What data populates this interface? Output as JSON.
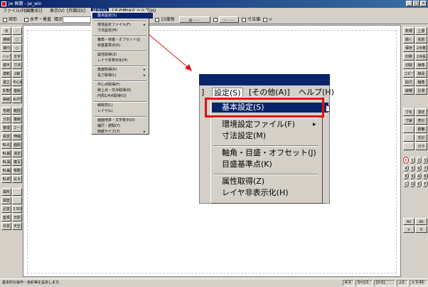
{
  "window": {
    "title": "jw 無題 - jw_win",
    "minimize": "_",
    "maximize": "□",
    "close": "×"
  },
  "menubar": {
    "items": [
      "ファイル(F)",
      "[編集(E)]",
      "表示(V)",
      "[作図(D)]",
      "設定(S)",
      "[その他(A)]",
      "ヘルプ(H)"
    ]
  },
  "toolbar": {
    "rect_label": "矩形",
    "hv_label": "水平・垂直",
    "tilt_label": "傾き",
    "dim_value_label": "寸法値",
    "ratio_label": "15度毎",
    "dot_arrow": "●――",
    "angle_arrow": "<――",
    "lt_label": "<"
  },
  "left_tools": [
    [
      "点",
      "／"
    ],
    [
      "接線",
      "□"
    ],
    [
      "接円",
      "○"
    ],
    [
      "ハッチ",
      "文字"
    ],
    [
      "建平",
      "寸法"
    ],
    [
      "建断",
      "2線"
    ],
    [
      "建立",
      "中心線"
    ],
    [
      "多角形",
      "連線"
    ],
    [
      "曲線",
      "AUTO"
    ],
    [
      "包絡",
      "範囲"
    ],
    [
      "分割",
      "複線"
    ],
    [
      "整理",
      "コーナー"
    ],
    [
      "属変",
      "伸縮"
    ],
    [
      "BL化",
      "面取"
    ],
    [
      "BL解",
      "消去"
    ],
    [
      "BL属",
      "複写"
    ],
    [
      "BL編",
      "移動"
    ],
    [
      "BL終",
      "戻る"
    ],
    [
      "図形",
      ""
    ],
    [
      "図登",
      ""
    ],
    [
      "記変",
      "2.5D"
    ],
    [
      "座標",
      "日影"
    ],
    [
      "外変",
      "天空"
    ]
  ],
  "right_tools": [
    [
      "新規",
      "上書"
    ],
    [
      "開く",
      "名前"
    ],
    [
      "保存",
      "2点角"
    ],
    [
      "印刷",
      "2点長"
    ],
    [
      "切取",
      "線角"
    ],
    [
      "コピー",
      "線長"
    ],
    [
      "貼付",
      "軸角"
    ],
    [
      "線種",
      "計測"
    ],
    [
      "寸化",
      "測定"
    ],
    [
      "寸解",
      "表計"
    ],
    [
      "",
      "距離"
    ],
    [
      "",
      "式計"
    ],
    [
      "",
      "ガラ"
    ]
  ],
  "layer_buttons": [
    "0",
    "1",
    "2",
    "3",
    "4",
    "5",
    "6",
    "7",
    "8",
    "9",
    "A",
    "B",
    "C",
    "D",
    "E",
    "F"
  ],
  "layer_extra": [
    "All",
    "All",
    "×",
    "0"
  ],
  "dropdown": {
    "items": [
      "基本設定(S)",
      "環境設定ファイル(F)",
      "寸法設定(M)",
      "軸角・目盛・オフセット(J)",
      "目盛基準点(K)",
      "属性取得(Z)",
      "レイヤ非表示化(H)",
      "角度取得(K)",
      "長さ取得(L)",
      "中心点取得(F)",
      "線上点・交点取得(R)",
      "円周1/4点取得(Q)",
      "線属性(L)",
      "レイヤ(L)",
      "画面倍率・文字表示(D)",
      "縮尺・読取(Y)",
      "用紙サイズ(Y)"
    ]
  },
  "zoom": {
    "menu": [
      "]",
      "設定(S)",
      "[その他(A)]",
      "ヘルプ(H)"
    ],
    "items": [
      "基本設定(S)",
      "環境設定ファイル(F)",
      "寸法設定(M)",
      "軸角・目盛・オフセット(J)",
      "目盛基準点(K)",
      "属性取得(Z)",
      "レイヤ非表示化(H)"
    ]
  },
  "status": {
    "message": "基本的な操作・色彩等を設定します。",
    "paper": "A-3",
    "scale": "S=1/1",
    "layer": "[0-0]",
    "angle": "∠0",
    "zoom": "× 0.46"
  },
  "colors": {
    "title_start": "#0a246a",
    "title_end": "#3a6ea5",
    "highlight": "#0a246a",
    "callout_border": "#e01010",
    "arrow": "#e01010"
  }
}
